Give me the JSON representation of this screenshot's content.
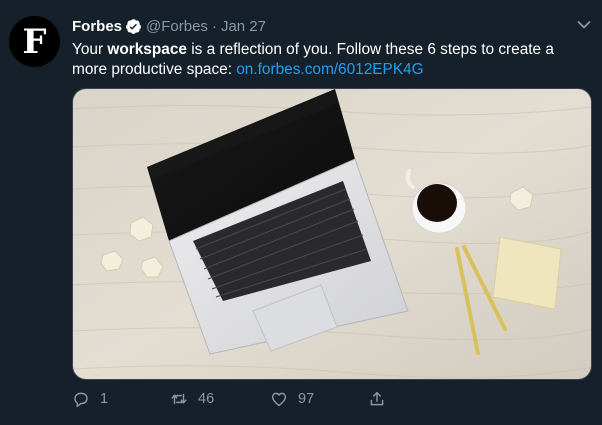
{
  "tweet": {
    "avatar_letter": "F",
    "display_name": "Forbes",
    "handle": "@Forbes",
    "separator": "·",
    "date": "Jan 27",
    "text_before": "Your ",
    "text_bold": "workspace",
    "text_after": " is a reflection of you. Follow these 6 steps to create a more productive space: ",
    "link": "on.forbes.com/6012EPK4G",
    "media_alt": "",
    "actions": {
      "reply_count": "1",
      "retweet_count": "46",
      "like_count": "97",
      "share_count": ""
    }
  },
  "colors": {
    "background": "#15202b",
    "text_secondary": "#8899a6",
    "link": "#1da1f2",
    "verified": "#ffffff"
  },
  "icons": [
    "verified-badge-icon",
    "chevron-down-icon",
    "reply-icon",
    "retweet-icon",
    "like-icon",
    "share-icon"
  ]
}
